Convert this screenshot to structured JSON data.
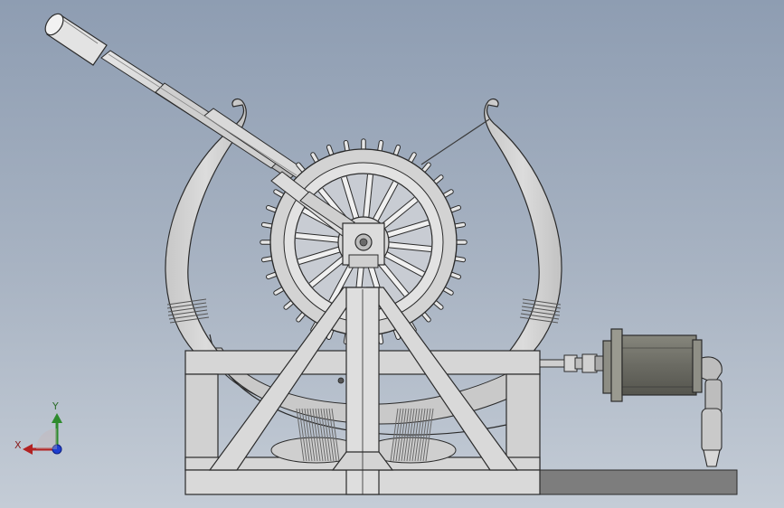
{
  "viewport": {
    "background_top": "#8e9db2",
    "background_bottom": "#c4ccd6"
  },
  "model": {
    "part_fill": "#d5d5d5",
    "part_edge": "#2b2b2b",
    "motor_fill": "#6b6b63",
    "base_plate_fill": "#7d7d7d"
  },
  "triad": {
    "x_label": "X",
    "y_label": "Y",
    "x_color": "#b22222",
    "y_color": "#2e8b2e",
    "z_color": "#1e3fd0"
  }
}
